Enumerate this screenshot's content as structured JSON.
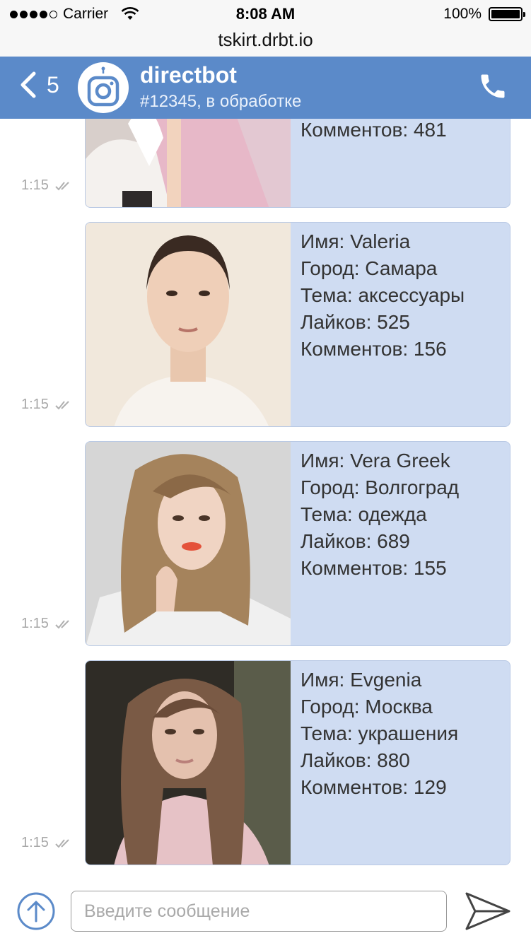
{
  "status_bar": {
    "carrier": "Carrier",
    "time": "8:08 AM",
    "battery": "100%",
    "signal_bars": 4
  },
  "url": "tskirt.drbt.io",
  "header": {
    "back_count": "5",
    "title": "directbot",
    "subtitle": "#12345, в обработке",
    "brand_color": "#5b8ac9"
  },
  "messages": [
    {
      "lines": [
        "Комментов: 481"
      ],
      "time": "1:15"
    },
    {
      "lines": [
        "Имя: Valeria",
        "Город: Самара",
        "Тема: аксессуары",
        "Лайков: 525",
        "Комментов: 156"
      ],
      "time": "1:15"
    },
    {
      "lines": [
        "Имя: Vera Greek",
        "Город: Волгоград",
        "Тема: одежда",
        "Лайков: 689",
        "Комментов: 155"
      ],
      "time": "1:15"
    },
    {
      "lines": [
        "Имя: Evgenia",
        "Город: Москва",
        "Тема: украшения",
        "Лайков: 880",
        "Комментов: 129"
      ],
      "time": "1:15"
    }
  ],
  "composer": {
    "placeholder": "Введите сообщение",
    "value": ""
  },
  "icons": {
    "back": "chevron-left-icon",
    "avatar": "instagram-robot-icon",
    "call": "phone-icon",
    "read_receipt": "double-check-icon",
    "upload": "arrow-up-circle-icon",
    "send": "send-arrow-icon"
  }
}
